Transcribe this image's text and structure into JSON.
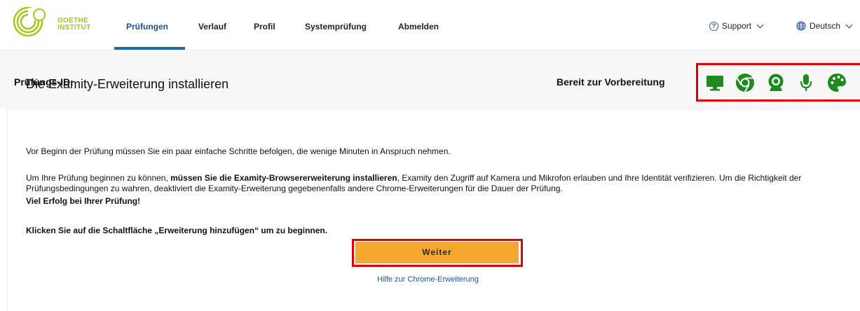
{
  "header": {
    "logo": {
      "line1": "GOETHE",
      "line2": "INSTITUT",
      "color": "#a0c814"
    },
    "nav": [
      {
        "label": "Prüfungen",
        "active": true
      },
      {
        "label": "Verlauf",
        "active": false
      },
      {
        "label": "Profil",
        "active": false
      },
      {
        "label": "Systemprüfung",
        "active": false
      },
      {
        "label": "Abmelden",
        "active": false
      }
    ],
    "support_label": "Support",
    "language_label": "Deutsch"
  },
  "exam_bar": {
    "id_label": "Prüfungs-ID:",
    "ready_label": "Bereit zur Vorbereitung",
    "status_icons": [
      "monitor-icon",
      "chrome-icon",
      "webcam-icon",
      "microphone-icon",
      "palette-icon"
    ],
    "status_color": "#1f8b1f",
    "highlight_color": "#e00000"
  },
  "main": {
    "title": "Die Examity-Erweiterung installieren",
    "intro": "Vor Beginn der Prüfung müssen Sie ein paar einfache Schritte befolgen, die wenige Minuten in Anspruch nehmen.",
    "para_start": "Um Ihre Prüfung beginnen zu können, ",
    "para_bold": "müssen Sie die Examity-Browsererweiterung installieren",
    "para_end": ", Examity den Zugriff auf Kamera und Mikrofon erlauben und Ihre Identität verifizieren. Um die Richtigkeit der Prüfungsbedingungen zu wahren, deaktiviert die Examity-Erweiterung gegebenenfalls andere Chrome-Erweiterungen für die Dauer der Prüfung.",
    "good_luck": "Viel Erfolg bei Ihrer Prüfung!",
    "instruction": "Klicken Sie auf die Schaltfläche „Erweiterung hinzufügen“ um zu beginnen.",
    "button_label": "Weiter",
    "button_color": "#f6a72e",
    "help_link": "Hilfe zur Chrome-Erweiterung"
  }
}
